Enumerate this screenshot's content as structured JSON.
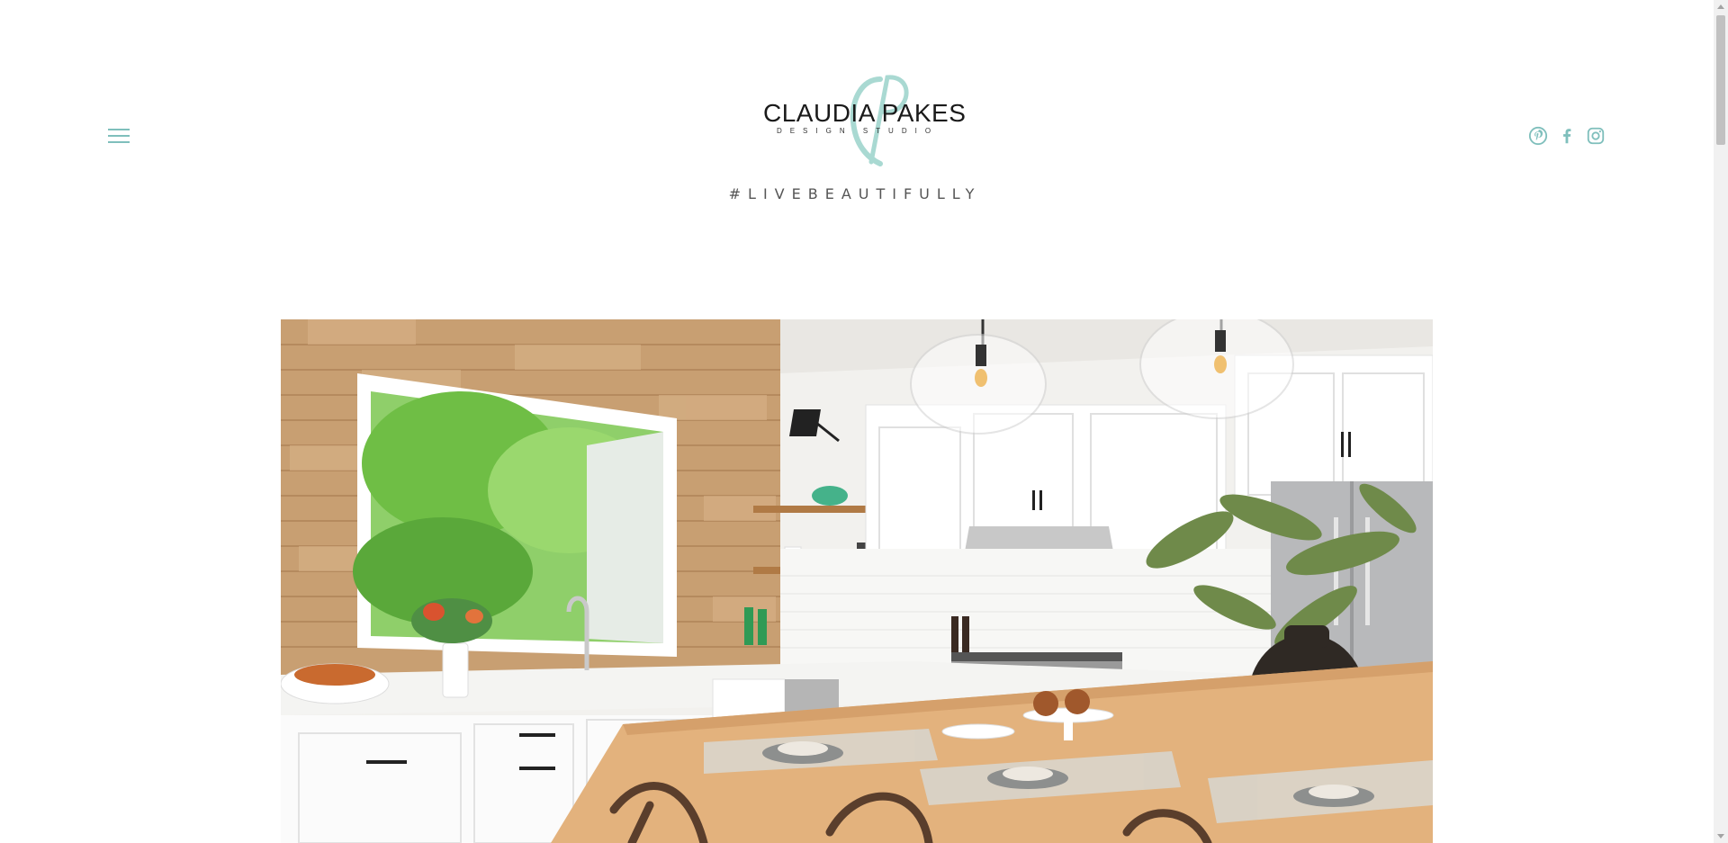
{
  "header": {
    "menu_icon": "hamburger-icon",
    "logo": {
      "name": "CLAUDIA PAKES",
      "sub": "DESIGN STUDIO",
      "monogram": "CP",
      "accent": "#a9d9d2"
    },
    "tagline": "#LIVEBEAUTIFULLY",
    "social": [
      {
        "icon": "pinterest-icon"
      },
      {
        "icon": "facebook-icon"
      },
      {
        "icon": "instagram-icon"
      }
    ],
    "accent_color": "#7fbfbc"
  },
  "hero": {
    "subject": "kitchen-photo"
  }
}
